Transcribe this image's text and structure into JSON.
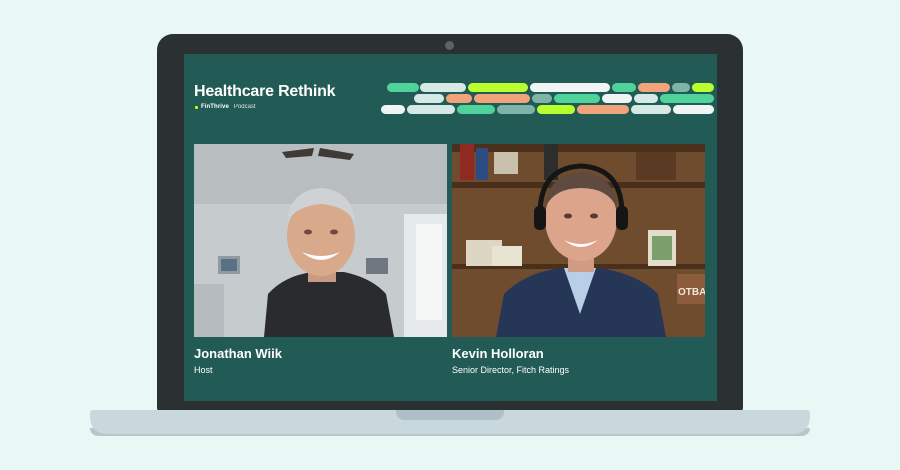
{
  "podcast": {
    "title": "Healthcare Rethink",
    "brand_name": "FinThrive",
    "brand_suffix": "Podcast"
  },
  "participants": [
    {
      "name": "Jonathan Wiik",
      "role": "Host"
    },
    {
      "name": "Kevin Holloran",
      "role": "Senior Director, Fitch Ratings"
    }
  ],
  "colors": {
    "background": "#e9f8f4",
    "screen": "#225a55",
    "accent_lime": "#b9ff2f",
    "stripe_green": "#4fd39a",
    "stripe_salmon": "#f1a37a",
    "stripe_light": "#d7e9e4"
  }
}
